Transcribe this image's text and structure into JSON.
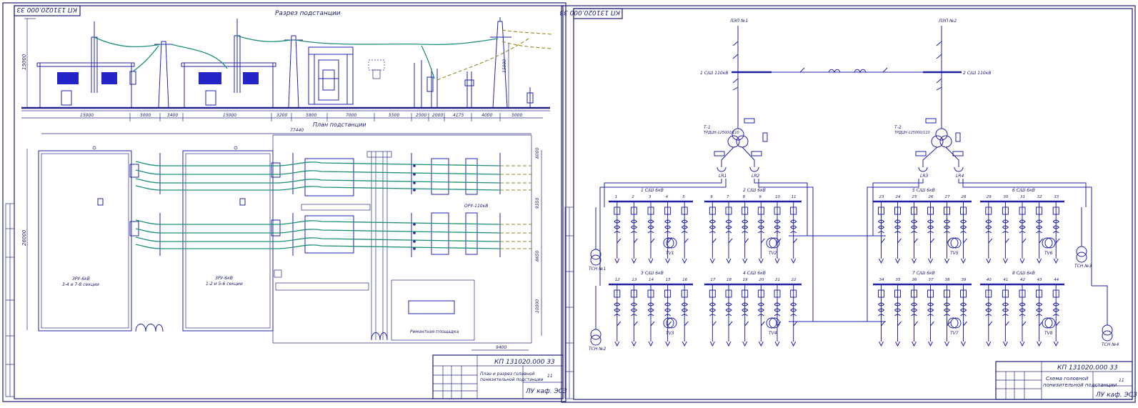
{
  "left_sheet": {
    "corner_code": "КП 131020.000 33",
    "section_title": "Разрез подстанции",
    "plan_title": "План подстанции",
    "height_dim_1": "15000",
    "height_dim_2": "15000",
    "plan_depth_dim": "26000",
    "section_dims": [
      "15000",
      "5000",
      "3400",
      "15000",
      "3200",
      "5800",
      "7000",
      "5500",
      "2500",
      "2000",
      "4175",
      "4000",
      "5000"
    ],
    "overall_dim": "77440",
    "right_dims": [
      "8000",
      "9350",
      "8650",
      "10000"
    ],
    "bottom_dim": "9400",
    "ru_label": "ОРУ-110кВ",
    "zru1_label_1": "ЗРУ-6кВ",
    "zru1_label_2": "3-4 и 7-8 секции",
    "zru2_label_1": "ЗРУ-6кВ",
    "zru2_label_2": "1-2 и 5-6 секции",
    "repair_label": "Ремонтная площадка",
    "stamp": {
      "code": "КП 131020.000 33",
      "title_1": "План и разрез головной",
      "title_2": "понизительной подстанции",
      "org": "ЛУ каф. ЭСЗ",
      "sheets": "11"
    }
  },
  "right_sheet": {
    "corner_code": "КП 131020.000 33",
    "line1_label": "ЛЭП №1",
    "line2_label": "ЛЭП №2",
    "bus110_1": "1 С/Ш 110кВ",
    "bus110_2": "2 С/Ш 110кВ",
    "t1_name": "Т-1",
    "t1_type": "ТРДЦН-125000/110",
    "t2_name": "Т-2",
    "t2_type": "ТРДЦН-125000/110",
    "lr_labels": [
      "LR1",
      "LR2",
      "LR3",
      "LR4"
    ],
    "sections": [
      {
        "name": "1 С/Ш 6кВ",
        "cells": [
          "1",
          "2",
          "3",
          "4",
          "5"
        ]
      },
      {
        "name": "2 С/Ш 6кВ",
        "cells": [
          "6",
          "7",
          "8",
          "9",
          "10",
          "11"
        ]
      },
      {
        "name": "5 С/Ш 6кВ",
        "cells": [
          "23",
          "24",
          "25",
          "26",
          "27",
          "28"
        ]
      },
      {
        "name": "6 С/Ш 6кВ",
        "cells": [
          "29",
          "30",
          "31",
          "32",
          "33"
        ]
      },
      {
        "name": "3 С/Ш 6кВ",
        "cells": [
          "12",
          "13",
          "14",
          "15",
          "16"
        ]
      },
      {
        "name": "4 С/Ш 6кВ",
        "cells": [
          "17",
          "18",
          "19",
          "20",
          "21",
          "22"
        ]
      },
      {
        "name": "7 С/Ш 6кВ",
        "cells": [
          "34",
          "35",
          "36",
          "37",
          "38",
          "39"
        ]
      },
      {
        "name": "8 С/Ш 6кВ",
        "cells": [
          "40",
          "41",
          "42",
          "43",
          "44"
        ]
      }
    ],
    "tv_labels": [
      "TV1",
      "TV2",
      "TV5",
      "TV6",
      "TV3",
      "TV4",
      "TV7",
      "TV8"
    ],
    "tsn_labels": [
      "ТСН №1",
      "ТСН №3",
      "ТСН №2",
      "ТСН №4"
    ],
    "stamp": {
      "code": "КП 131020.000 33",
      "title_1": "Схема головной",
      "title_2": "понизительной подстанции",
      "org": "ЛУ каф. ЭСЗ",
      "sheets": "11"
    }
  }
}
